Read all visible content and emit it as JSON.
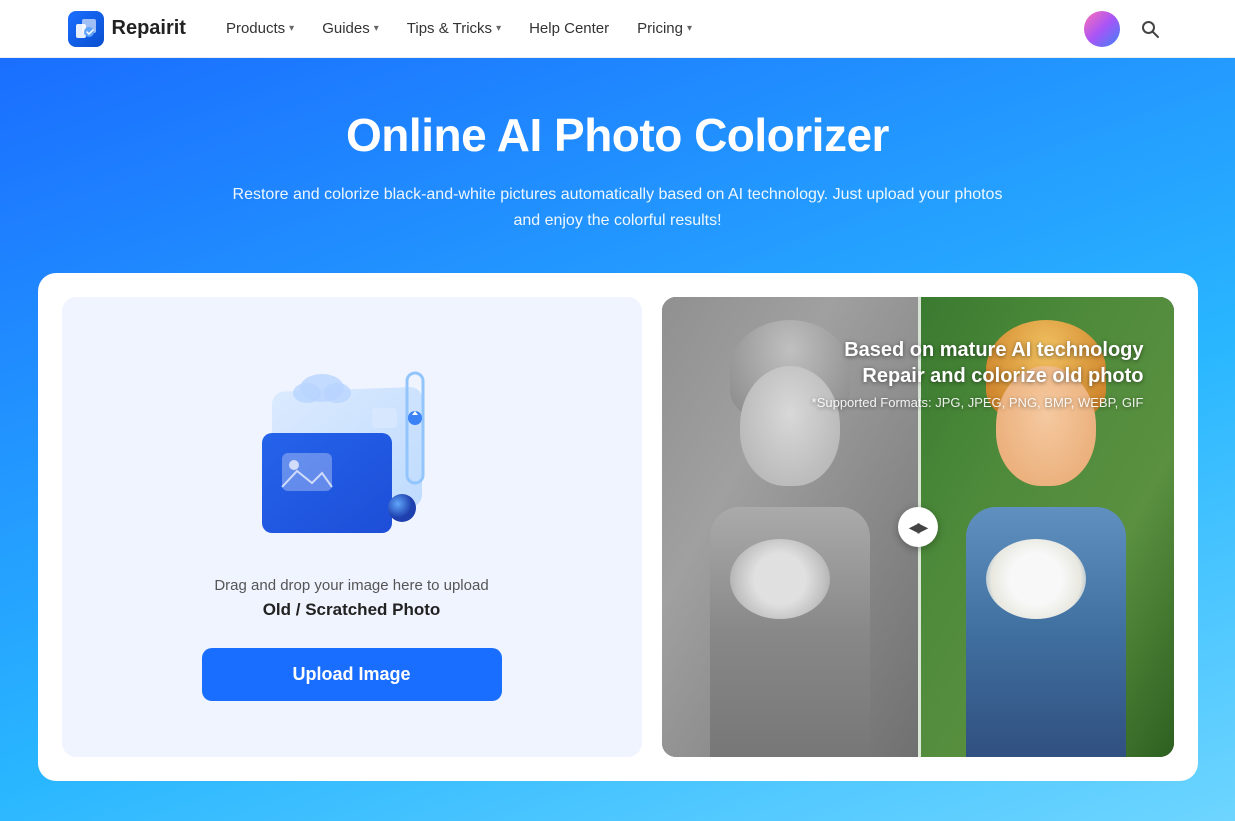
{
  "navbar": {
    "logo_text": "Repairit",
    "logo_icon": "R",
    "nav_items": [
      {
        "label": "Products",
        "has_dropdown": true
      },
      {
        "label": "Guides",
        "has_dropdown": true
      },
      {
        "label": "Tips & Tricks",
        "has_dropdown": true
      },
      {
        "label": "Help Center",
        "has_dropdown": false
      },
      {
        "label": "Pricing",
        "has_dropdown": true
      }
    ],
    "search_icon": "🔍"
  },
  "hero": {
    "title": "Online AI Photo Colorizer",
    "subtitle": "Restore and colorize black-and-white pictures automatically based on AI technology. Just upload your photos and enjoy the colorful results!"
  },
  "upload_area": {
    "drag_text": "Drag and drop your image here to upload",
    "file_type": "Old / Scratched Photo",
    "upload_button": "Upload Image"
  },
  "preview": {
    "overlay_main": "Based on mature AI technology\nRepair and colorize old photo",
    "overlay_main_line1": "Based on mature AI technology",
    "overlay_main_line2": "Repair and colorize old photo",
    "overlay_sub": "*Supported Formats: JPG, JPEG, PNG, BMP, WEBP, GIF"
  }
}
